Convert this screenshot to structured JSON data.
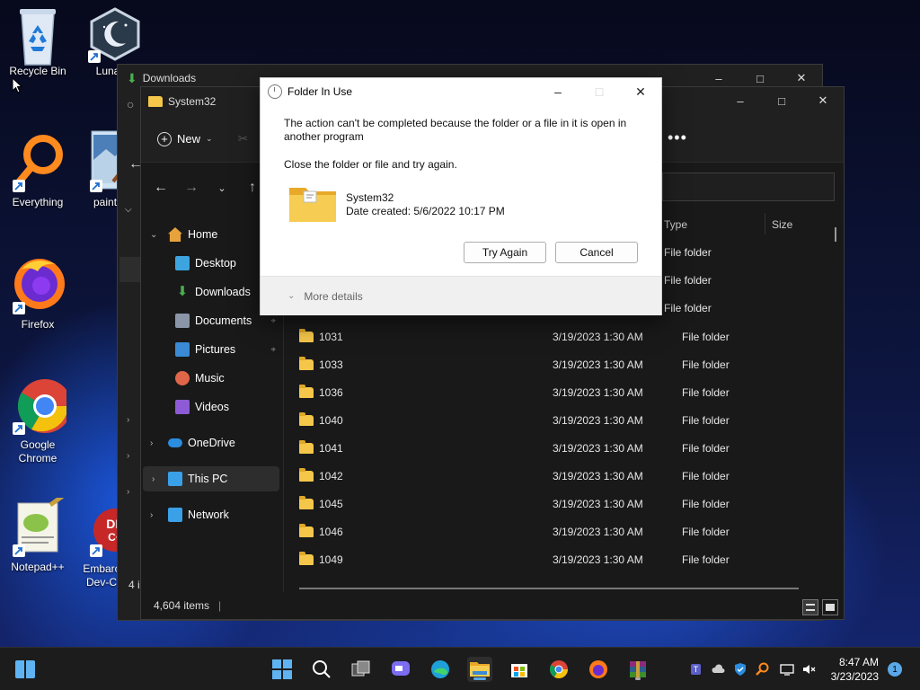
{
  "desktop": {
    "icons": [
      {
        "label": "Recycle Bin",
        "icon": "recycle-bin-icon"
      },
      {
        "label": "Lunar C",
        "icon": "lunar-client-icon"
      },
      {
        "label": "Everything",
        "icon": "everything-search-icon"
      },
      {
        "label": "paint",
        "icon": "paint-icon"
      },
      {
        "label": "Firefox",
        "icon": "firefox-icon"
      },
      {
        "label": "Google Chrome",
        "icon": "chrome-icon"
      },
      {
        "label": "Notepad++",
        "icon": "notepadpp-icon"
      },
      {
        "label": "Embarc Dev-C",
        "icon": "embarcadero-devcpp-icon"
      }
    ]
  },
  "back_window": {
    "title": "Downloads",
    "status_count": "4 i"
  },
  "explorer": {
    "title": "System32",
    "new_label": "New",
    "columns": {
      "type": "Type",
      "size": "Size"
    },
    "sidebar": {
      "home": "Home",
      "desktop": "Desktop",
      "downloads": "Downloads",
      "documents": "Documents",
      "pictures": "Pictures",
      "music": "Music",
      "videos": "Videos",
      "onedrive": "OneDrive",
      "thispc": "This PC",
      "network": "Network"
    },
    "top_rows_type": [
      "File folder",
      "File folder",
      "File folder"
    ],
    "rows": [
      {
        "name": "1031",
        "date": "3/19/2023 1:30 AM",
        "type": "File folder"
      },
      {
        "name": "1033",
        "date": "3/19/2023 1:30 AM",
        "type": "File folder"
      },
      {
        "name": "1036",
        "date": "3/19/2023 1:30 AM",
        "type": "File folder"
      },
      {
        "name": "1040",
        "date": "3/19/2023 1:30 AM",
        "type": "File folder"
      },
      {
        "name": "1041",
        "date": "3/19/2023 1:30 AM",
        "type": "File folder"
      },
      {
        "name": "1042",
        "date": "3/19/2023 1:30 AM",
        "type": "File folder"
      },
      {
        "name": "1045",
        "date": "3/19/2023 1:30 AM",
        "type": "File folder"
      },
      {
        "name": "1046",
        "date": "3/19/2023 1:30 AM",
        "type": "File folder"
      },
      {
        "name": "1049",
        "date": "3/19/2023 1:30 AM",
        "type": "File folder"
      }
    ],
    "status": "4,604 items"
  },
  "dialog": {
    "title": "Folder In Use",
    "message": "The action can't be completed because the folder or a file in it is open in another program",
    "instruction": "Close the folder or file and try again.",
    "item_name": "System32",
    "item_date": "Date created: 5/6/2022 10:17 PM",
    "try_again": "Try Again",
    "cancel": "Cancel",
    "more_details": "More details"
  },
  "taskbar": {
    "time": "8:47 AM",
    "date": "3/23/2023",
    "notification_count": "1"
  },
  "colors": {
    "accent": "#5aa8e8",
    "folder": "#f4c64a",
    "window_bg": "#191919",
    "dialog_bg": "#ffffff"
  }
}
